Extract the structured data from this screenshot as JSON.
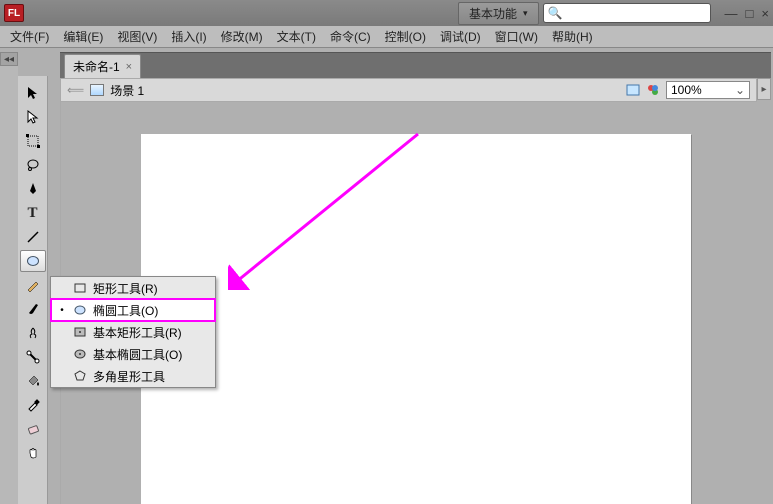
{
  "title": {
    "logo": "FL"
  },
  "workspace": {
    "label": "基本功能"
  },
  "search": {
    "placeholder": ""
  },
  "menu": {
    "file": "文件(F)",
    "edit": "编辑(E)",
    "view": "视图(V)",
    "insert": "插入(I)",
    "modify": "修改(M)",
    "text": "文本(T)",
    "commands": "命令(C)",
    "control": "控制(O)",
    "debug": "调试(D)",
    "window": "窗口(W)",
    "help": "帮助(H)"
  },
  "tabs": [
    {
      "label": "未命名-1"
    }
  ],
  "scene": {
    "label": "场景 1"
  },
  "zoom": {
    "value": "100%"
  },
  "flyout": {
    "items": [
      {
        "label": "矩形工具(R)"
      },
      {
        "label": "椭圆工具(O)",
        "selected": true
      },
      {
        "label": "基本矩形工具(R)"
      },
      {
        "label": "基本椭圆工具(O)"
      },
      {
        "label": "多角星形工具"
      }
    ]
  }
}
